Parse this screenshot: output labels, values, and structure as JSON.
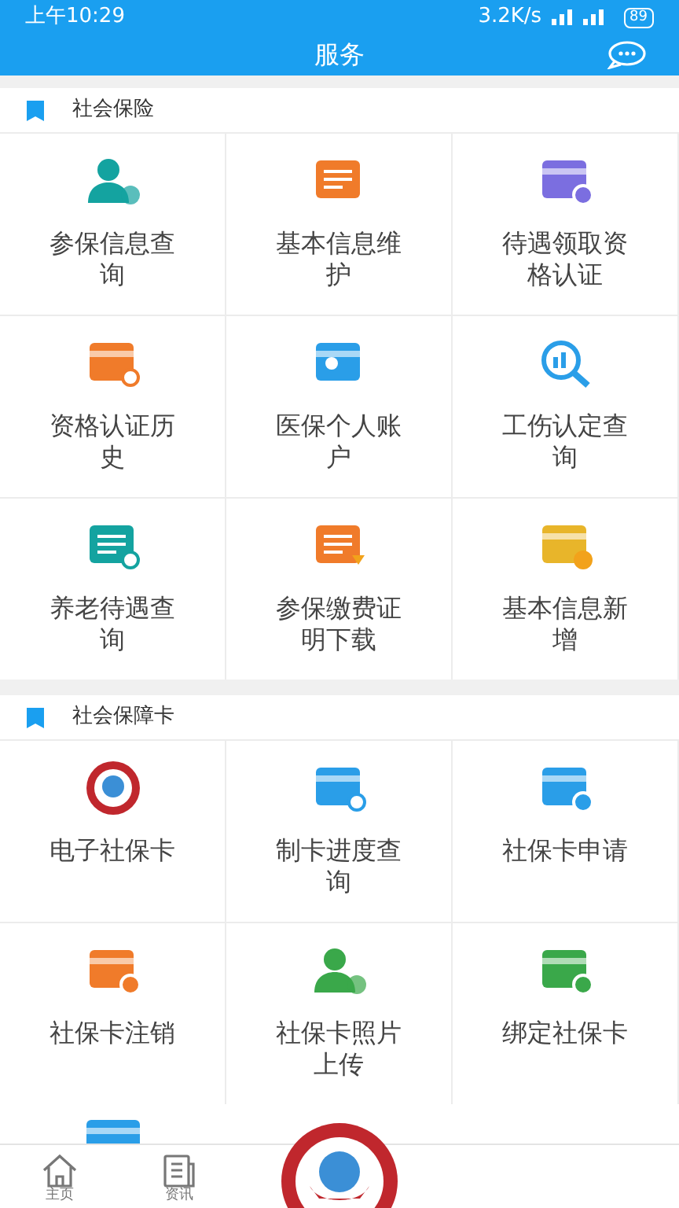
{
  "status_bar": {
    "time": "上午10:29",
    "speed": "3.2K/s",
    "battery": "89"
  },
  "header": {
    "title": "服务"
  },
  "sections": [
    {
      "title": "社会保险",
      "items": [
        {
          "label": "参保信息查询"
        },
        {
          "label": "基本信息维护"
        },
        {
          "label": "待遇领取资格认证"
        },
        {
          "label": "资格认证历史"
        },
        {
          "label": "医保个人账户"
        },
        {
          "label": "工伤认定查询"
        },
        {
          "label": "养老待遇查询"
        },
        {
          "label": "参保缴费证明下载"
        },
        {
          "label": "基本信息新增"
        }
      ]
    },
    {
      "title": "社会保障卡",
      "items": [
        {
          "label": "电子社保卡"
        },
        {
          "label": "制卡进度查询"
        },
        {
          "label": "社保卡申请"
        },
        {
          "label": "社保卡注销"
        },
        {
          "label": "社保卡照片上传"
        },
        {
          "label": "绑定社保卡"
        }
      ]
    }
  ],
  "nav": [
    {
      "label": "主页",
      "selected": false
    },
    {
      "label": "资讯",
      "selected": false
    }
  ]
}
